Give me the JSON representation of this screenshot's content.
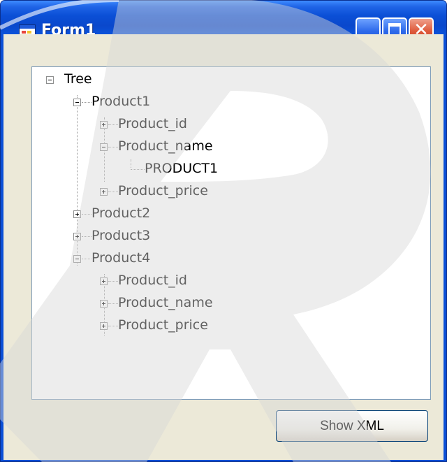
{
  "window": {
    "title": "Form1",
    "controls": {
      "minimize": "minimize",
      "maximize": "maximize",
      "close": "close"
    }
  },
  "tree": {
    "root": "Tree",
    "nodes": [
      {
        "label": "Product1",
        "state": "expanded",
        "children": [
          {
            "label": "Product_id",
            "state": "collapsed"
          },
          {
            "label": "Product_name",
            "state": "expanded",
            "children": [
              {
                "label": "PRODUCT1"
              }
            ]
          },
          {
            "label": "Product_price",
            "state": "collapsed"
          }
        ]
      },
      {
        "label": "Product2",
        "state": "collapsed"
      },
      {
        "label": "Product3",
        "state": "collapsed"
      },
      {
        "label": "Product4",
        "state": "expanded",
        "children": [
          {
            "label": "Product_id",
            "state": "collapsed"
          },
          {
            "label": "Product_name",
            "state": "collapsed"
          },
          {
            "label": "Product_price",
            "state": "collapsed"
          }
        ]
      }
    ]
  },
  "buttons": {
    "show_xml": "Show XML"
  },
  "colors": {
    "titlebar": "#0b4fd6",
    "client": "#ece9d8",
    "close_button": "#de5a3b",
    "tree_border": "#7f9db9"
  }
}
